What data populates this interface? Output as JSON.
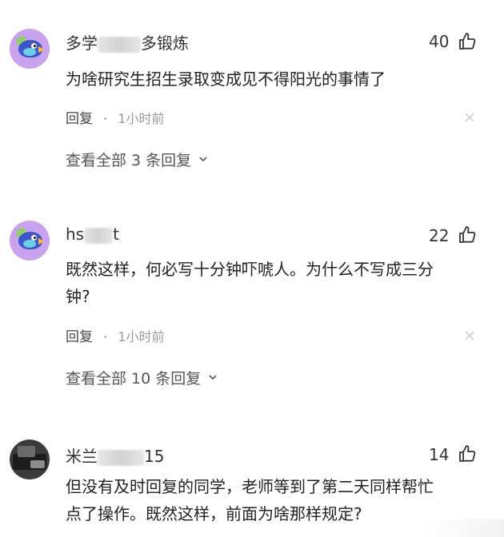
{
  "comments": [
    {
      "avatar": "bird-avatar",
      "name_start": "多学",
      "name_end": "多锻炼",
      "likes": "40",
      "text_lines": [
        "为啥研究生招生录取变成见不得阳光的事情了"
      ],
      "reply_label": "回复",
      "separator": "·",
      "time": "1小时前",
      "view_replies": "查看全部 3 条回复"
    },
    {
      "avatar": "bird-avatar",
      "name_start": "hs",
      "name_end": "t",
      "likes": "22",
      "text_lines": [
        "既然这样，何必写十分钟吓唬人。为什么不写成三分",
        "钟?"
      ],
      "reply_label": "回复",
      "separator": "·",
      "time": "1小时前",
      "view_replies": "查看全部 10 条回复"
    },
    {
      "avatar": "photo-avatar",
      "name_start": "米兰",
      "name_end": "15",
      "likes": "14",
      "text_lines": [
        "但没有及时回复的同学，老师等到了第二天同样帮忙",
        "点了操作。既然这样，前面为啥那样规定?"
      ]
    }
  ],
  "icons": {
    "like": "thumbs-up-icon",
    "close": "close-icon",
    "chevron": "chevron-down-icon"
  },
  "colors": {
    "text": "#222222",
    "meta": "#9a9a9a",
    "avatar_purple": "#c9a3ee"
  }
}
